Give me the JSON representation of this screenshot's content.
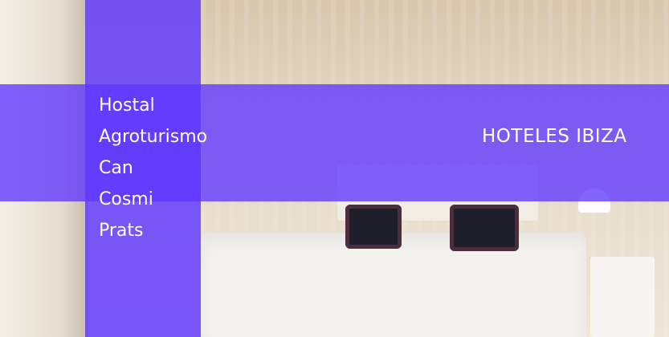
{
  "hotel_name_lines": [
    "Hostal",
    "Agroturismo",
    "Can",
    "Cosmi",
    "Prats"
  ],
  "region_label": "HOTELES IBIZA",
  "colors": {
    "overlay": "#5e37ff",
    "text": "#ffffff"
  }
}
